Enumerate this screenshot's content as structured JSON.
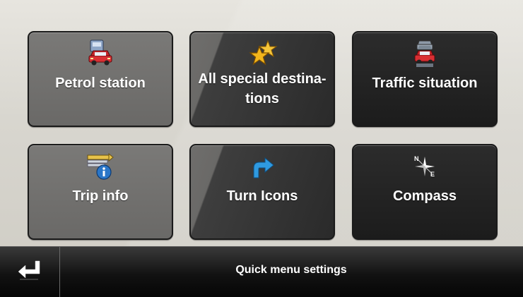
{
  "menu": {
    "tiles": [
      {
        "label": "Petrol station",
        "icon": "petrol-station-icon"
      },
      {
        "label": "All special destina-\ntions",
        "icon": "star-icon"
      },
      {
        "label": "Traffic situation",
        "icon": "traffic-icon"
      },
      {
        "label": "Trip info",
        "icon": "trip-info-icon"
      },
      {
        "label": "Turn Icons",
        "icon": "turn-arrow-icon"
      },
      {
        "label": "Compass",
        "icon": "compass-icon"
      }
    ]
  },
  "footer": {
    "title": "Quick menu settings",
    "back_icon": "back-return-icon"
  },
  "colors": {
    "tile_light": "#6f6e6c",
    "tile_dark": "#262626",
    "background": "#dcdad3",
    "footer": "#0a0a0a",
    "accent_blue": "#2f9ae0",
    "accent_gold": "#f2b51c"
  }
}
